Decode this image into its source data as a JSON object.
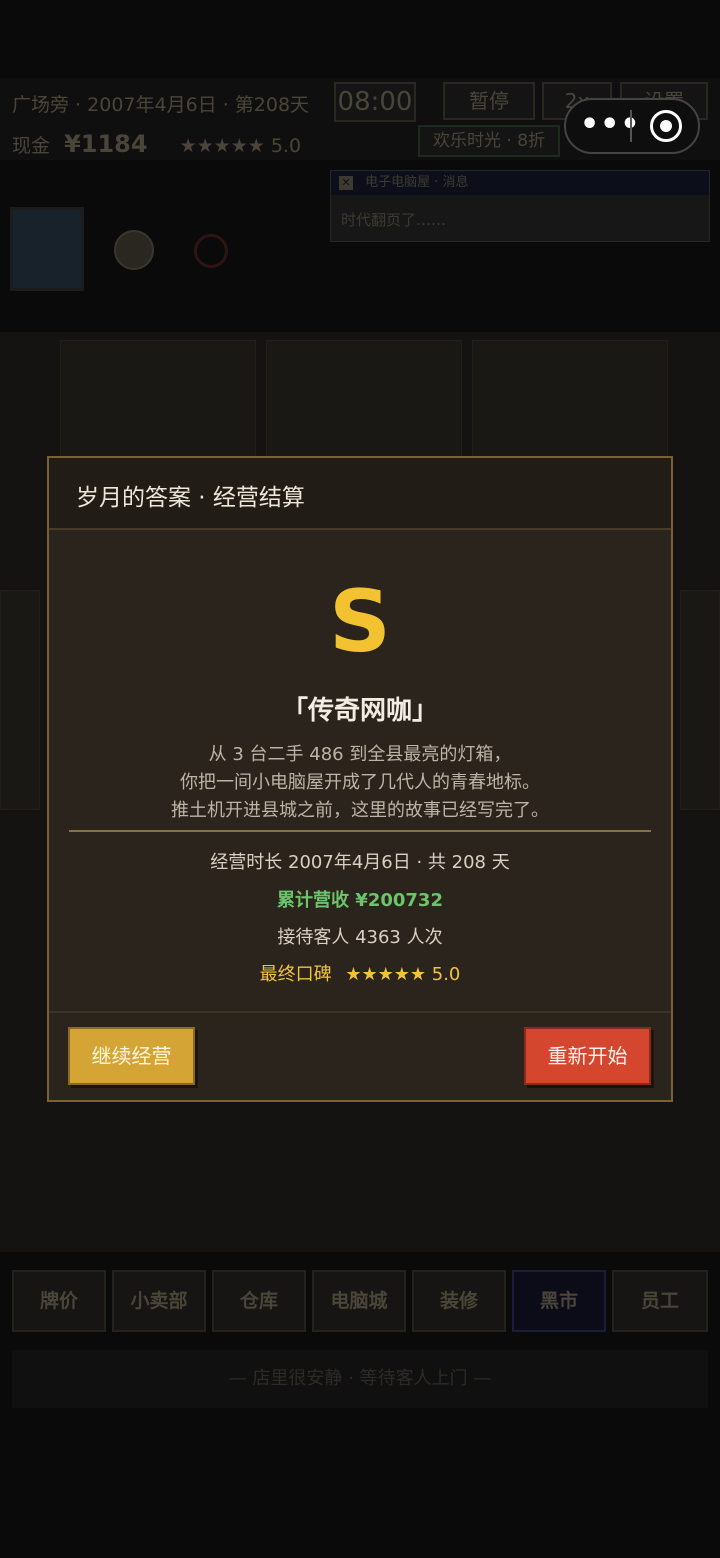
{
  "hud": {
    "location": "广场旁",
    "date": "2007年4月6日",
    "day": "第208天",
    "clock": "08:00",
    "pause_label": "暂停",
    "speed_label": "2x",
    "settings_label": "设置",
    "cash_label": "现金",
    "cash_value": "¥1184",
    "rating": "★★★★★ 5.0",
    "happy_hour": "欢乐时光 · 8折"
  },
  "notice": {
    "source": "电子电脑屋 · 消息",
    "text": "时代翻页了……"
  },
  "tabs": [
    "牌价",
    "小卖部",
    "仓库",
    "电脑城",
    "装修",
    "黑市",
    "员工"
  ],
  "status_bar": "— 店里很安静 · 等待客人上门 —",
  "modal": {
    "title": "岁月的答案 · 经营结算",
    "grade": "S",
    "ending_name": "「传奇网咖」",
    "description": [
      "从 3 台二手 486 到全县最亮的灯箱，",
      "你把一间小电脑屋开成了几代人的青春地标。",
      "推土机开进县城之前，这里的故事已经写完了。"
    ],
    "duration": "经营时长  2007年4月6日 · 共 208 天",
    "revenue": "累计营收  ¥200732",
    "customers": "接待客人  4363 人次",
    "reputation_label": "最终口碑",
    "reputation_stars": "★★★★★",
    "reputation_score": "5.0",
    "continue_label": "继续经营",
    "restart_label": "重新开始"
  },
  "colors": {
    "accent_gold": "#f2c230",
    "revenue_green": "#6cc46c",
    "restart_red": "#d5462e",
    "continue_gold": "#d4a534"
  }
}
